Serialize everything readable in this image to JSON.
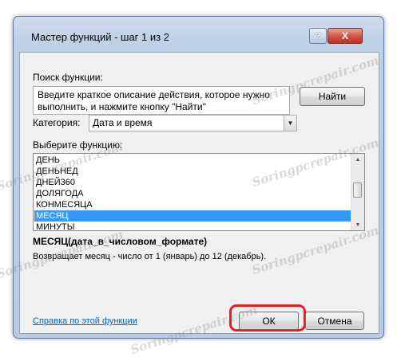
{
  "window": {
    "title": "Мастер функций - шаг 1 из 2",
    "help_glyph": "?",
    "close_glyph": "X"
  },
  "search": {
    "label": "Поиск функции:",
    "text": "Введите краткое описание действия, которое нужно выполнить, и нажмите кнопку \"Найти\"",
    "find_button": "Найти"
  },
  "category": {
    "label": "Категория:",
    "selected": "Дата и время"
  },
  "functions": {
    "label": "Выберите функцию:",
    "items": [
      "ДЕНЬ",
      "ДЕНЬНЕД",
      "ДНЕЙ360",
      "ДОЛЯГОДА",
      "КОНМЕСЯЦА",
      "МЕСЯЦ",
      "МИНУТЫ"
    ],
    "selected_index": 5,
    "scroll_position": 0.35
  },
  "signature": "МЕСЯЦ(дата_в_числовом_формате)",
  "description": "Возвращает месяц - число от 1 (январь) до 12 (декабрь).",
  "footer": {
    "help_link": "Справка по этой функции",
    "ok": "ОК",
    "cancel": "Отмена"
  },
  "watermark": "Soringpcrepair.com",
  "colors": {
    "selection": "#3399ff",
    "highlight_ring": "#e02020",
    "link": "#0066cc"
  },
  "icons": [
    "help-icon",
    "close-icon",
    "dropdown-arrow-icon",
    "scroll-up-icon",
    "scroll-down-icon"
  ]
}
